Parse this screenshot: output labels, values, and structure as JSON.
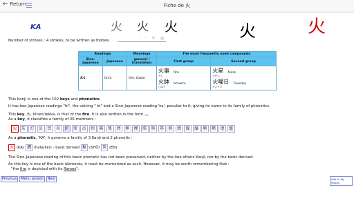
{
  "header": {
    "back_label": "Return",
    "title": "Fiche de 火"
  },
  "kanji": {
    "reading_on": "KA",
    "glyphs": [
      "火",
      "火",
      "火",
      "火",
      "火"
    ],
    "strokes_text": "Number of strokes : 4 strokes, to be written as follows",
    "stroke_sequence": "' ' ソ 火"
  },
  "table": {
    "headers": {
      "readings": "Readings",
      "meanings": "Meanings",
      "compounds": "The most frequently used compounds"
    },
    "subheaders": {
      "sino": "Sino-Japanese",
      "japanese": "Japanese",
      "meaning": "general / translation",
      "first": "First group",
      "second": "Second group"
    },
    "row": {
      "on": "KA",
      "kun": "hi-bi",
      "meaning": "fire, flame",
      "first": [
        {
          "word": "火事",
          "reading": "かじ",
          "trans": "fire"
        },
        {
          "word": "火鉢",
          "reading": "ひばち",
          "trans": "brasero"
        }
      ],
      "second": [
        {
          "word": "火星",
          "reading": "かせい",
          "trans": "Mars"
        },
        {
          "word": "火曜日",
          "reading": "かようび",
          "trans": "Tuesday"
        }
      ]
    }
  },
  "text": {
    "line1_a": "This Kanji is one of the 102 ",
    "line1_b": "keys",
    "line1_c": " and ",
    "line1_d": "phonetics",
    "line1_e": ".",
    "line2": "It has two Japanese readings \"hi\", the voicing \" bi\" and a Sino-Japanese reading 'ka', peculiar to it, giving its name to its family of phonetics.",
    "line3_a": "This ",
    "line3_b": "key",
    "line3_c": ", 火, hihen/rekka, is that of the ",
    "line3_d": "fire",
    "line3_e": ". It is also written in the form ⺣.",
    "line4_a": "As a ",
    "line4_b": "key",
    "line4_c": ", it classifies a family of 26 members :",
    "line5_a": "As a ",
    "line5_b": "phonetic",
    "line5_c": ", 'KA', it governs a family of 3 Kanji and 2 phonetic :",
    "line6": "The Sino-Japanese reading of this basic phonetic has not been preserved, neither by the two others Kanji, nor by the basic derived.",
    "line7": "As this key is one of the basic elements, it must be memorized as such. However, it may be worth remembering that :",
    "line8_a": "\"the ",
    "line8_b": "fire",
    "line8_c": " is depicted with its ",
    "line8_d": "flames",
    "line8_e": "\"."
  },
  "key_family": [
    "火",
    "灰",
    "灯",
    "災",
    "炊",
    "炎",
    "炉",
    "炭",
    "点",
    "烈",
    "無",
    "焦",
    "然",
    "煮",
    "煙",
    "照",
    "熊",
    "熟",
    "熱",
    "燃",
    "燥",
    "爆",
    "勲",
    "黙",
    "燈",
    "爐"
  ],
  "phonetic": {
    "kanji1": "火",
    "reading1": "(KA)",
    "kanji2": "畑",
    "reading2": "(hata(ke))",
    "label1": "- basic derived",
    "kanji3": "秋",
    "reading3": "(SHŪ)",
    "kanji4": "炎",
    "reading4": "(EN)"
  },
  "nav": {
    "previous": "Previous",
    "menu": "Menu Lesson",
    "next": "Next",
    "add": "Add to My lesson"
  },
  "colors": {
    "accent": "#5bc4f0",
    "kanji_red": "#d40000",
    "ka_blue": "#1c3b9c"
  }
}
